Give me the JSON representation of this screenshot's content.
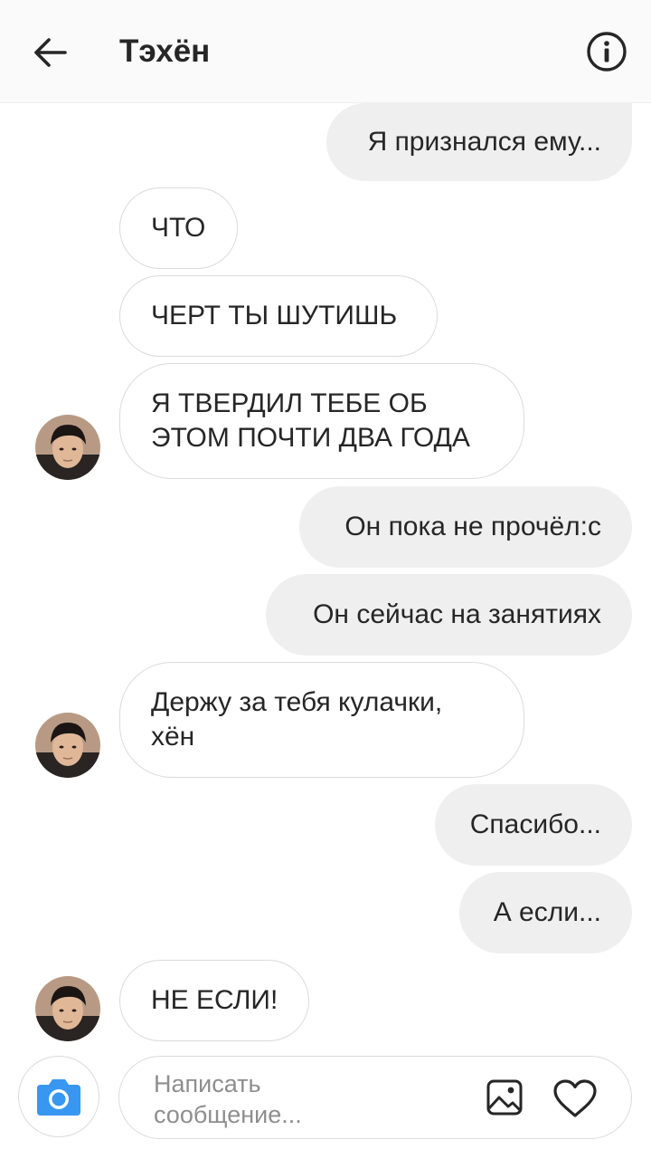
{
  "header": {
    "title": "Тэхён",
    "back_icon": "arrow-left-icon",
    "info_icon": "info-circle-icon"
  },
  "messages": [
    {
      "direction": "out",
      "text": "Я признался ему..."
    },
    {
      "direction": "in",
      "text": "ЧТО"
    },
    {
      "direction": "in",
      "text": "ЧЕРТ ТЫ ШУТИШЬ"
    },
    {
      "direction": "in",
      "text": "Я ТВЕРДИЛ ТЕБЕ ОБ ЭТОМ ПОЧТИ ДВА ГОДА"
    },
    {
      "direction": "out",
      "text": "Он пока не прочёл:с"
    },
    {
      "direction": "out",
      "text": "Он сейчас на занятиях"
    },
    {
      "direction": "in",
      "text": "Держу за тебя кулачки, хён"
    },
    {
      "direction": "out",
      "text": "Спасибо..."
    },
    {
      "direction": "out",
      "text": "А если..."
    },
    {
      "direction": "in",
      "text": "НЕ ЕСЛИ!"
    }
  ],
  "composer": {
    "placeholder": "Написать сообщение...",
    "camera_icon": "camera-icon",
    "gallery_icon": "image-gallery-icon",
    "heart_icon": "heart-icon"
  },
  "colors": {
    "outgoing_bubble": "#efefef",
    "incoming_border": "#dbdbdb",
    "camera_accent": "#3897f0",
    "text": "#262626",
    "placeholder": "#8e8e8e"
  }
}
